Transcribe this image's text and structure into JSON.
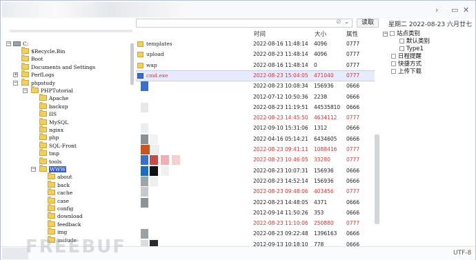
{
  "window": {
    "controls": {
      "forward": "›",
      "restore": "▭",
      "close": "✕"
    }
  },
  "toolbar": {
    "path_placeholder": "",
    "clear_glyph": "⊘",
    "dropdown_glyph": "⌄",
    "read_label": "读取",
    "datetime": "星期二  2022-08-23  六月廿七"
  },
  "tree": {
    "root": "C:",
    "items": [
      "$Recycle.Bin",
      "Boot",
      "Documents and Settings",
      "PerfLogs",
      "phpstudy",
      "PHPTutorial",
      "Apache",
      "backup",
      "IIS",
      "MySQL",
      "nginx",
      "php",
      "SQL-Front",
      "tmp",
      "tools",
      "WWW",
      "about",
      "back",
      "cache",
      "case",
      "config",
      "download",
      "feedback",
      "img",
      "include"
    ]
  },
  "columns": {
    "time": "时间",
    "size": "大小",
    "attr": "属性"
  },
  "files": [
    {
      "name": "templates",
      "time": "2022-08-16 11:48:14",
      "size": "4096",
      "attr": "0777",
      "red": false,
      "type": "folder"
    },
    {
      "name": "upload",
      "time": "2022-08-23 11:48:14",
      "size": "4096",
      "attr": "0777",
      "red": false,
      "type": "folder"
    },
    {
      "name": "wap",
      "time": "2022-08-16 11:48:14",
      "size": "0",
      "attr": "0777",
      "red": false,
      "type": "folder"
    },
    {
      "name": "cmd.exe",
      "time": "2022-08-23 15:04:05",
      "size": "471040",
      "attr": "0777",
      "red": true,
      "type": "exe"
    },
    {
      "name": "",
      "time": "2022-08-23 10:08:34",
      "size": "156936",
      "attr": "0666",
      "red": false
    },
    {
      "name": "",
      "time": "2012-07-12 10:50:36",
      "size": "2238",
      "attr": "0666",
      "red": false
    },
    {
      "name": "",
      "time": "2022-08-23 11:19:51",
      "size": "44535810",
      "attr": "0666",
      "red": false
    },
    {
      "name": "",
      "time": "2022-08-23 14:45:50",
      "size": "4634112",
      "attr": "0777",
      "red": true
    },
    {
      "name": "",
      "time": "2012-09-10 15:31:06",
      "size": "1312",
      "attr": "0666",
      "red": false
    },
    {
      "name": "",
      "time": "2022-04-16 05:14:21",
      "size": "6434605",
      "attr": "0666",
      "red": false
    },
    {
      "name": "",
      "time": "2022-08-23 09:41:11",
      "size": "1088416",
      "attr": "0777",
      "red": true
    },
    {
      "name": "",
      "time": "2022-08-23 10:46:05",
      "size": "33280",
      "attr": "0777",
      "red": true
    },
    {
      "name": "",
      "time": "2022-08-23 10:07:31",
      "size": "156936",
      "attr": "0666",
      "red": false
    },
    {
      "name": "",
      "time": "2022-08-23 14:52:14",
      "size": "156936",
      "attr": "0666",
      "red": false
    },
    {
      "name": "",
      "time": "2022-08-23 09:48:06",
      "size": "403456",
      "attr": "0777",
      "red": true
    },
    {
      "name": "",
      "time": "2022-08-23 14:48:05",
      "size": "4371",
      "attr": "0666",
      "red": false
    },
    {
      "name": "",
      "time": "2012-09-14 11:50:26",
      "size": "353",
      "attr": "0666",
      "red": false
    },
    {
      "name": "",
      "time": "2022-08-23 11:10:06",
      "size": "250880",
      "attr": "0777",
      "red": true
    },
    {
      "name": "",
      "time": "2022-08-23 09:22:48",
      "size": "1396163",
      "attr": "0666",
      "red": false
    },
    {
      "name": "",
      "time": "2012-09-13 10:18:10",
      "size": "778",
      "attr": "0666",
      "red": false
    }
  ],
  "right_panel": {
    "site_category": "站点类别",
    "default_category": "默认类别",
    "type1": "Type1",
    "schedule": "日程提醒",
    "shortcut": "快捷方式",
    "upload_download": "上传下载"
  },
  "status": {
    "encoding": "UTF-8"
  },
  "watermark": "FREEBUF",
  "colors": {
    "selection": "#2c5fd9",
    "red_text": "#e03030",
    "highlight_row": "#e6ebff"
  }
}
